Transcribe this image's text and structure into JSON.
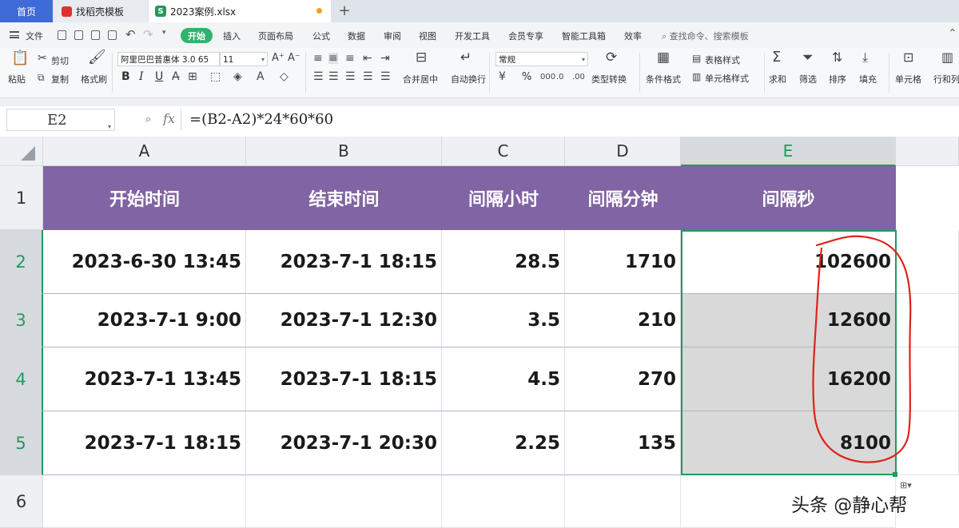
{
  "tabs": {
    "home": "首页",
    "template": "找稻壳模板",
    "file": "2023案例.xlsx",
    "new_tab": "+"
  },
  "menu": {
    "file": "文件",
    "items": [
      "开始",
      "插入",
      "页面布局",
      "公式",
      "数据",
      "审阅",
      "视图",
      "开发工具",
      "会员专享",
      "智能工具箱",
      "效率"
    ],
    "search": "查找命令、搜索模板"
  },
  "ribbon": {
    "paste": "粘贴",
    "cut": "剪切",
    "copy": "复制",
    "format_painter": "格式刷",
    "font_name": "阿里巴巴普惠体 3.0 65",
    "font_size": "11",
    "merge_center": "合并居中",
    "wrap_text": "自动换行",
    "number_format": "常规",
    "type_convert": "类型转换",
    "conditional_format": "条件格式",
    "table_style": "表格样式",
    "cell_style": "单元格样式",
    "sum": "求和",
    "filter": "筛选",
    "sort": "排序",
    "fill": "填充",
    "cell": "单元格",
    "row_col": "行和列",
    "bold": "B",
    "italic": "I",
    "underline": "U",
    "percent": "%"
  },
  "formula_bar": {
    "name_box": "E2",
    "fx": "fx",
    "formula": "=(B2-A2)*24*60*60"
  },
  "sheet": {
    "columns": [
      "A",
      "B",
      "C",
      "D",
      "E"
    ],
    "selected_column": "E",
    "rows": [
      "1",
      "2",
      "3",
      "4",
      "5",
      "6"
    ],
    "header": [
      "开始时间",
      "结束时间",
      "间隔小时",
      "间隔分钟",
      "间隔秒"
    ],
    "data": [
      [
        "2023-6-30 13:45",
        "2023-7-1 18:15",
        "28.5",
        "1710",
        "102600"
      ],
      [
        "2023-7-1 9:00",
        "2023-7-1 12:30",
        "3.5",
        "210",
        "12600"
      ],
      [
        "2023-7-1 13:45",
        "2023-7-1 18:15",
        "4.5",
        "270",
        "16200"
      ],
      [
        "2023-7-1 18:15",
        "2023-7-1 20:30",
        "2.25",
        "135",
        "8100"
      ]
    ],
    "header_color": "#8164a3",
    "selection_color": "#1f9b5c",
    "annotation_color": "#e0211b"
  },
  "watermark": "头条 @静心帮"
}
